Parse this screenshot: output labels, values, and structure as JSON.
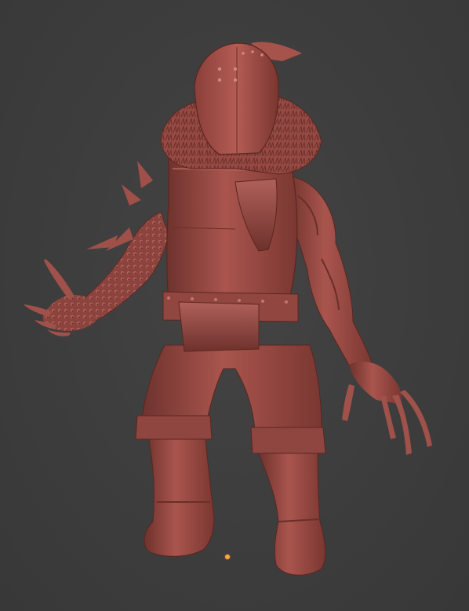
{
  "viewport": {
    "background_color": "#3b3b3b"
  },
  "model": {
    "material_color": "#9a4a44",
    "shadow_color": "#5a2622",
    "highlight_color": "#c27a6f",
    "parts": [
      "helmet",
      "fur-collar",
      "chest-plate",
      "shield-plate",
      "belt",
      "left-arm-scaled",
      "right-arm-muscular",
      "left-claw-hand",
      "right-claw-hand",
      "trousers",
      "left-boot",
      "right-boot"
    ]
  },
  "pivot": {
    "color": "#ffa640"
  }
}
